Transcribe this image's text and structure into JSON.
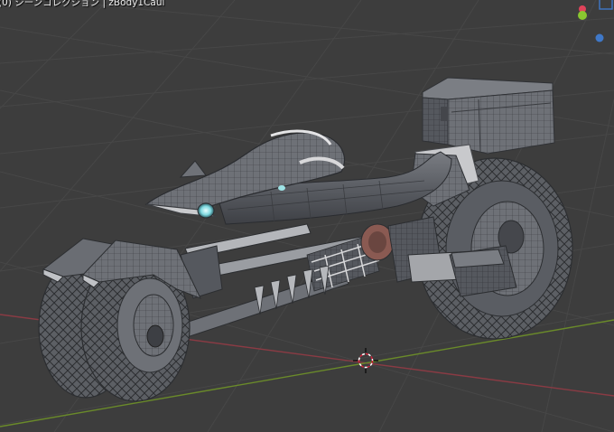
{
  "viewport": {
    "info_text": "(0) シーンコレクション | zBody1Caul"
  },
  "gizmo": {
    "x_color": "#e0435a",
    "y_color": "#8ac630",
    "z_color": "#3f78c8",
    "x_icon": "axis-x-icon",
    "y_icon": "axis-y-icon",
    "z_icon": "axis-z-icon"
  },
  "colors": {
    "background": "#3d3d3d",
    "grid": "#474747",
    "x_axis": "#8a3b44",
    "y_axis": "#6a8a2a",
    "mesh": "#6b6e74",
    "wire": "#35373b",
    "cursor_red": "#d2223a"
  }
}
